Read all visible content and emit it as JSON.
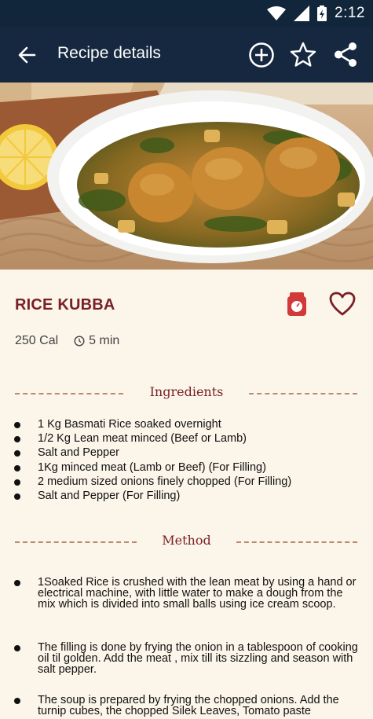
{
  "status_bar": {
    "time": "2:12"
  },
  "app_bar": {
    "title": "Recipe details",
    "icons": [
      "back-arrow-icon",
      "add-circle-icon",
      "star-icon",
      "share-icon"
    ]
  },
  "recipe": {
    "name": "RICE KUBBA",
    "calories": "250 Cal",
    "time": "5 min"
  },
  "ingredients": {
    "heading": "Ingredients",
    "items": [
      "1 Kg Basmati Rice soaked overnight",
      "1/2 Kg Lean meat minced (Beef or Lamb)",
      "Salt and Pepper",
      "1Kg minced meat (Lamb or Beef) (For Filling)",
      "2 medium sized onions finely chopped (For Filling)",
      "Salt and Pepper (For Filling)"
    ]
  },
  "method": {
    "heading": "Method",
    "steps": [
      "1Soaked Rice is crushed with the lean meat by using a hand or electrical machine, with little water to make a dough from the mix which is divided into small balls using ice cream scoop.",
      "The filling is done by frying the onion in a tablespoon of cooking oil til golden. Add the meat , mix till its sizzling and season with salt  pepper.",
      "The soup is prepared by frying the chopped onions. Add the turnip cubes, the chopped Silek Leaves, Tomato paste"
    ]
  },
  "colors": {
    "app_bar": "#16283f",
    "status_bar": "#11253b",
    "background": "#fbf5ea",
    "accent": "#7a1f25",
    "dash": "#b98a6e"
  }
}
